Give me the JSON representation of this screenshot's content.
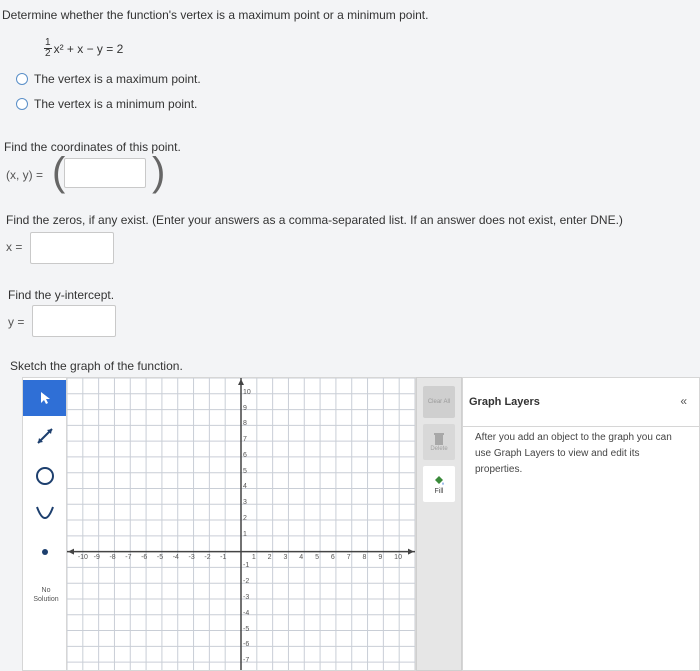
{
  "question": {
    "prompt": "Determine whether the function's vertex is a maximum point or a minimum point.",
    "equation": {
      "frac_num": "1",
      "frac_den": "2",
      "rest": "x² + x − y = 2"
    },
    "options": [
      "The vertex is a maximum point.",
      "The vertex is a minimum point."
    ]
  },
  "coordinates": {
    "label": "Find the coordinates of this point.",
    "xy_label": "(x, y) =",
    "value": ""
  },
  "zeros": {
    "label": "Find the zeros, if any exist. (Enter your answers as a comma-separated list. If an answer does not exist, enter DNE.)",
    "x_label": "x =",
    "value": ""
  },
  "intercept": {
    "label": "Find the y-intercept.",
    "y_label": "y =",
    "value": ""
  },
  "sketch": {
    "label": "Sketch the graph of the function."
  },
  "tools": {
    "no_solution_label": "No Solution",
    "icons": [
      "arrow-cursor-icon",
      "line-tool-icon",
      "circle-tool-icon",
      "parabola-tool-icon",
      "point-tool-icon"
    ]
  },
  "side_tools": {
    "clear_all": "Clear All",
    "delete": "Delete",
    "fill": "Fill"
  },
  "layers_panel": {
    "title": "Graph Layers",
    "collapse": "«",
    "description": "After you add an object to the graph you can use Graph Layers to view and edit its properties."
  },
  "graph": {
    "x_ticks": [
      "-10",
      "-9",
      "-8",
      "-7",
      "-6",
      "-5",
      "-4",
      "-3",
      "-2",
      "-1",
      "1",
      "2",
      "3",
      "4",
      "5",
      "6",
      "7",
      "8",
      "9",
      "10"
    ],
    "y_ticks_pos": [
      "10",
      "9",
      "8",
      "7",
      "6",
      "5",
      "4",
      "3",
      "2",
      "1"
    ],
    "y_ticks_neg": [
      "-1",
      "-2",
      "-3",
      "-4",
      "-5",
      "-6",
      "-7"
    ],
    "xlim": [
      -11,
      11
    ],
    "ylim": [
      -7.5,
      11
    ]
  }
}
